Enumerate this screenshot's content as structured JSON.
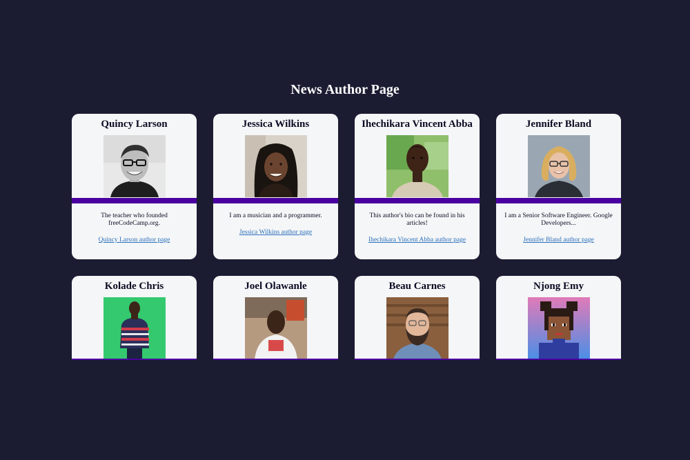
{
  "page": {
    "title": "News Author Page"
  },
  "authors": [
    {
      "name": "Quincy Larson",
      "bio": "The teacher who founded freeCodeCamp.org.",
      "link": "Quincy Larson author page",
      "avatar_icon": "avatar-photo-bw"
    },
    {
      "name": "Jessica Wilkins",
      "bio": "I am a musician and a programmer.",
      "link": "Jessica Wilkins author page",
      "avatar_icon": "avatar-photo"
    },
    {
      "name": "Ihechikara Vincent Abba",
      "bio": "This author's bio can be found in his articles!",
      "link": "Ihechikara Vincent Abba author page",
      "avatar_icon": "avatar-photo"
    },
    {
      "name": "Jennifer Bland",
      "bio": "I am a Senior Software Engineer. Google Developers...",
      "link": "Jennifer Bland author page",
      "avatar_icon": "avatar-photo"
    },
    {
      "name": "Kolade Chris",
      "avatar_icon": "avatar-photo"
    },
    {
      "name": "Joel Olawanle",
      "avatar_icon": "avatar-photo"
    },
    {
      "name": "Beau Carnes",
      "avatar_icon": "avatar-photo"
    },
    {
      "name": "Njong Emy",
      "avatar_icon": "avatar-pixel-art"
    }
  ],
  "colors": {
    "background": "#1b1b32",
    "card": "#f5f6f7",
    "divider": "#4a00a0",
    "link": "#2a6fbb"
  }
}
